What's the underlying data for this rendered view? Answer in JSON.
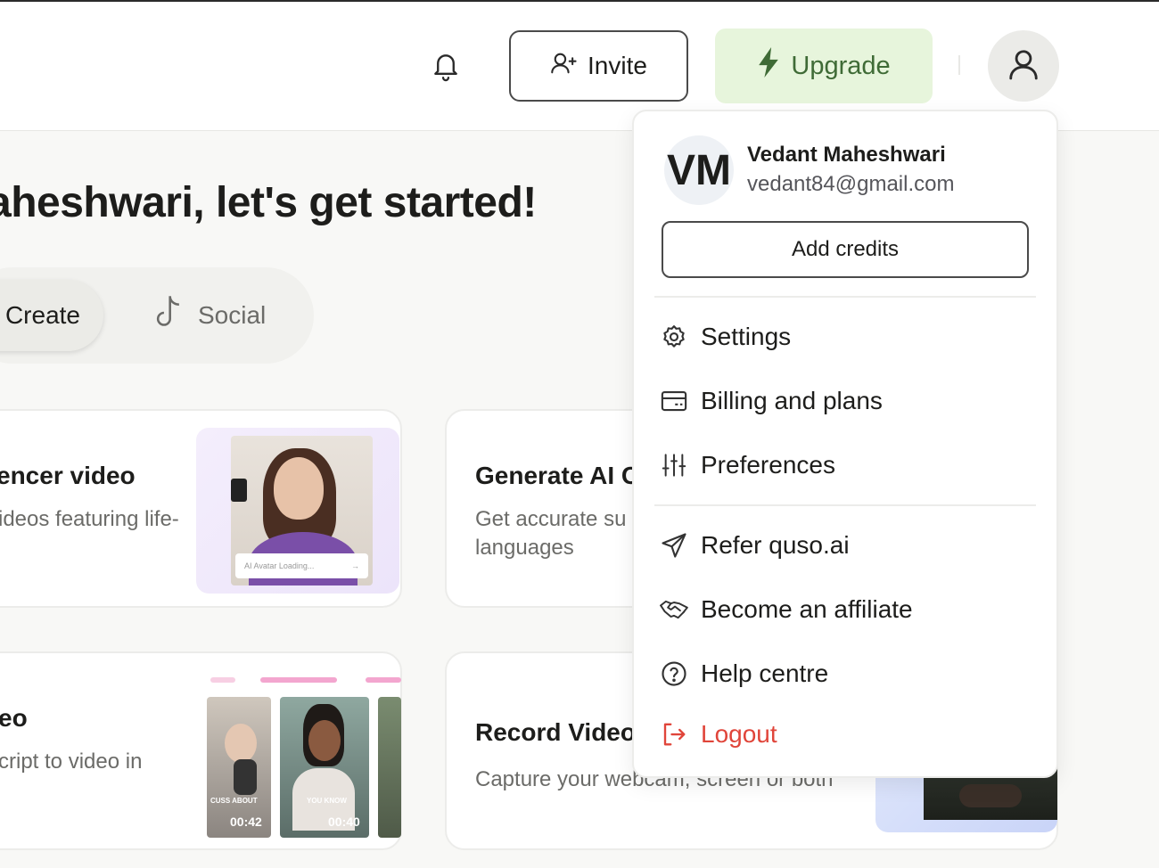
{
  "header": {
    "invite_label": "Invite",
    "upgrade_label": "Upgrade"
  },
  "main": {
    "headline": "aheshwari, let's get started!",
    "tabs": [
      {
        "label": "Create"
      },
      {
        "label": "Social"
      }
    ],
    "cards": [
      {
        "title": "encer video",
        "desc": "ideos featuring life-",
        "badge": "AI Avatar Loading..."
      },
      {
        "title": "Generate AI C",
        "desc_lines": [
          "Get accurate su",
          "languages"
        ]
      },
      {
        "title": "eo",
        "desc": "cript to video in",
        "clips": [
          {
            "caption": "CUSS ABOUT",
            "time": "00:42"
          },
          {
            "caption": "YOU KNOW",
            "time": "00:40"
          }
        ]
      },
      {
        "title": "Record Video",
        "desc": "Capture your webcam, screen or both"
      }
    ]
  },
  "menu": {
    "avatar_initials": "VM",
    "name": "Vedant Maheshwari",
    "email": "vedant84@gmail.com",
    "add_credits_label": "Add credits",
    "items": [
      {
        "label": "Settings",
        "icon": "gear-icon"
      },
      {
        "label": "Billing and plans",
        "icon": "credit-card-icon"
      },
      {
        "label": "Preferences",
        "icon": "sliders-icon"
      },
      {
        "label": "Refer quso.ai",
        "icon": "send-icon"
      },
      {
        "label": "Become an affiliate",
        "icon": "handshake-icon"
      },
      {
        "label": "Help centre",
        "icon": "help-circle-icon"
      },
      {
        "label": "Logout",
        "icon": "logout-icon"
      }
    ]
  },
  "colors": {
    "upgrade_bg": "#e7f5dc",
    "upgrade_text": "#3f6b36",
    "logout": "#e0453a"
  }
}
